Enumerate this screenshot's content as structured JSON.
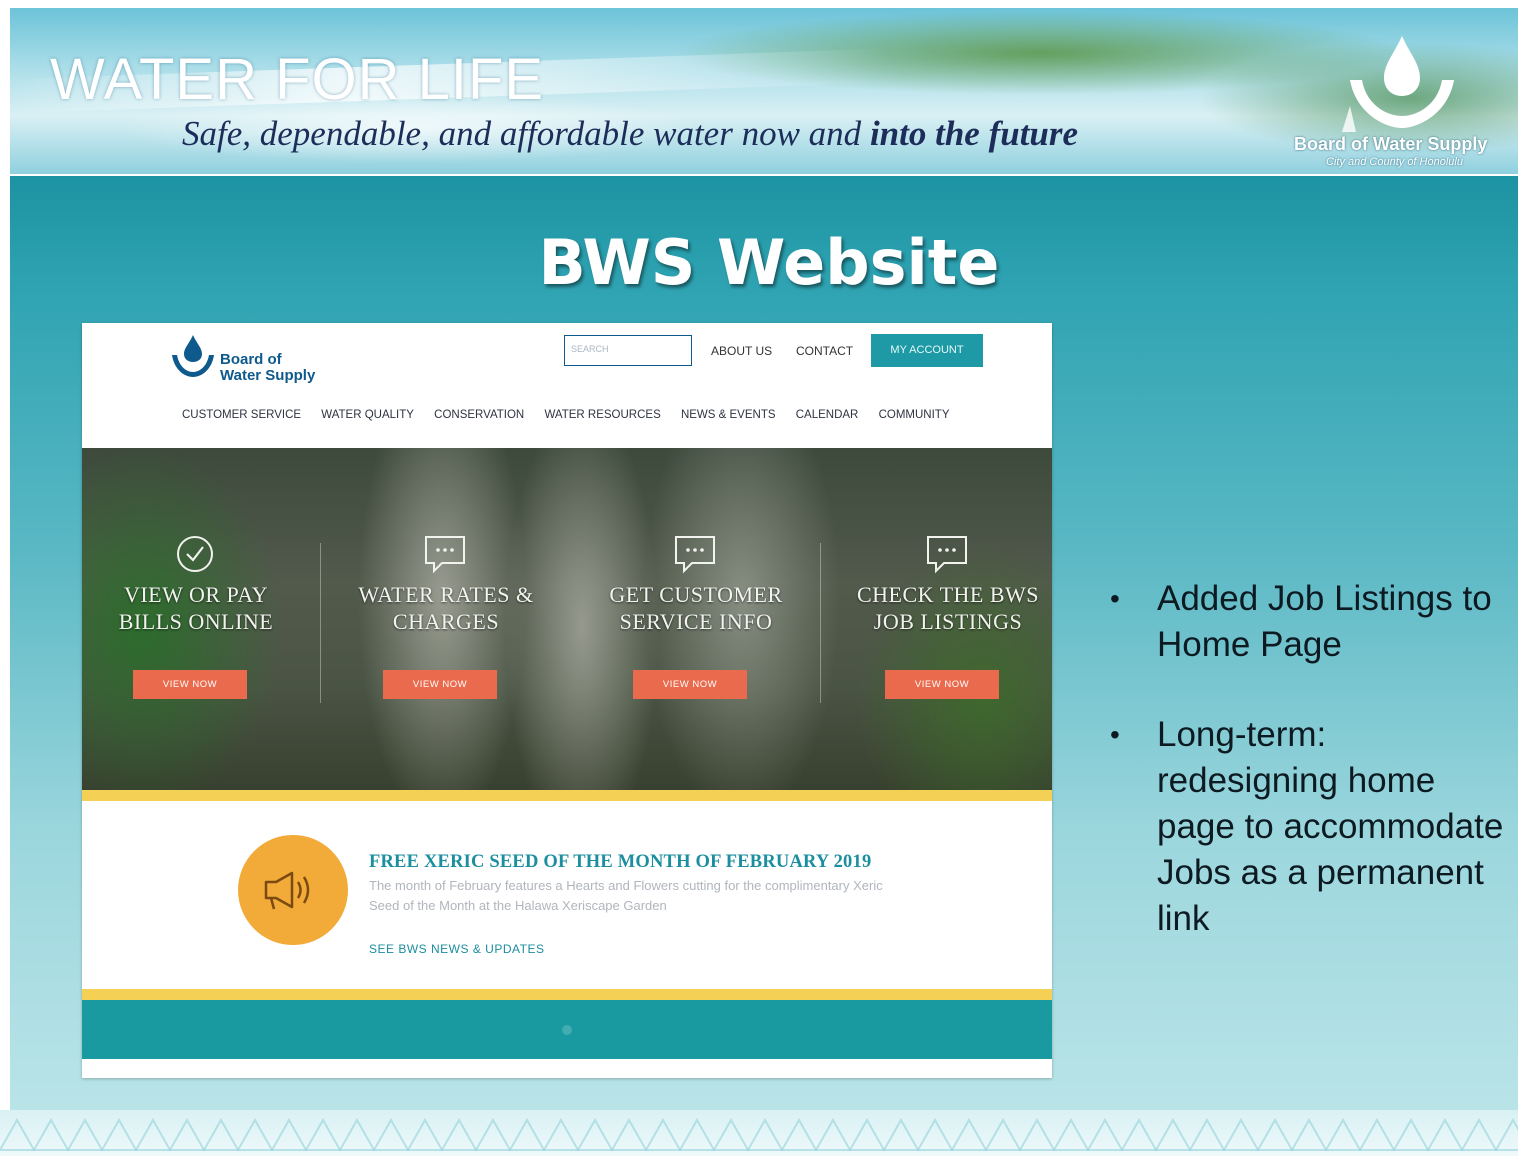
{
  "banner": {
    "title": "WATER FOR LIFE",
    "tagline_plain": "Safe, dependable, and affordable water now and ",
    "tagline_bold": "into the future",
    "logo_name": "Board of Water Supply",
    "logo_sub": "City and County of Honolulu"
  },
  "slide": {
    "title": "BWS Website"
  },
  "website": {
    "logo_line1": "Board of",
    "logo_line2": "Water Supply",
    "search_placeholder": "SEARCH",
    "top_links": [
      "ABOUT US",
      "CONTACT"
    ],
    "account_button": "MY ACCOUNT",
    "nav": [
      "CUSTOMER SERVICE",
      "WATER QUALITY",
      "CONSERVATION",
      "WATER RESOURCES",
      "NEWS & EVENTS",
      "CALENDAR",
      "COMMUNITY"
    ],
    "tiles": [
      {
        "icon": "check-circle-icon",
        "line1": "VIEW OR PAY",
        "line2": "BILLS ONLINE",
        "button": "VIEW NOW"
      },
      {
        "icon": "chat-bubble-icon",
        "line1": "WATER RATES &",
        "line2": "CHARGES",
        "button": "VIEW NOW"
      },
      {
        "icon": "chat-bubble-icon",
        "line1": "GET CUSTOMER",
        "line2": "SERVICE INFO",
        "button": "VIEW NOW"
      },
      {
        "icon": "chat-bubble-icon",
        "line1": "CHECK THE BWS",
        "line2": "JOB LISTINGS",
        "button": "VIEW NOW"
      }
    ],
    "news": {
      "icon": "megaphone-icon",
      "title": "FREE XERIC SEED OF THE MONTH OF FEBRUARY 2019",
      "body": "The month of February features a Hearts and Flowers cutting for the complimentary Xeric Seed of the Month at the Halawa Xeriscape Garden",
      "link": "SEE BWS NEWS & UPDATES"
    },
    "colors": {
      "accent": "#1d9aa5",
      "button": "#ea6a4d",
      "yellow": "#f4d155",
      "news_icon": "#f2aa38"
    }
  },
  "bullets": [
    "Added Job Listings to Home Page",
    "Long-term: redesigning home page to accommodate Jobs as a permanent link"
  ]
}
